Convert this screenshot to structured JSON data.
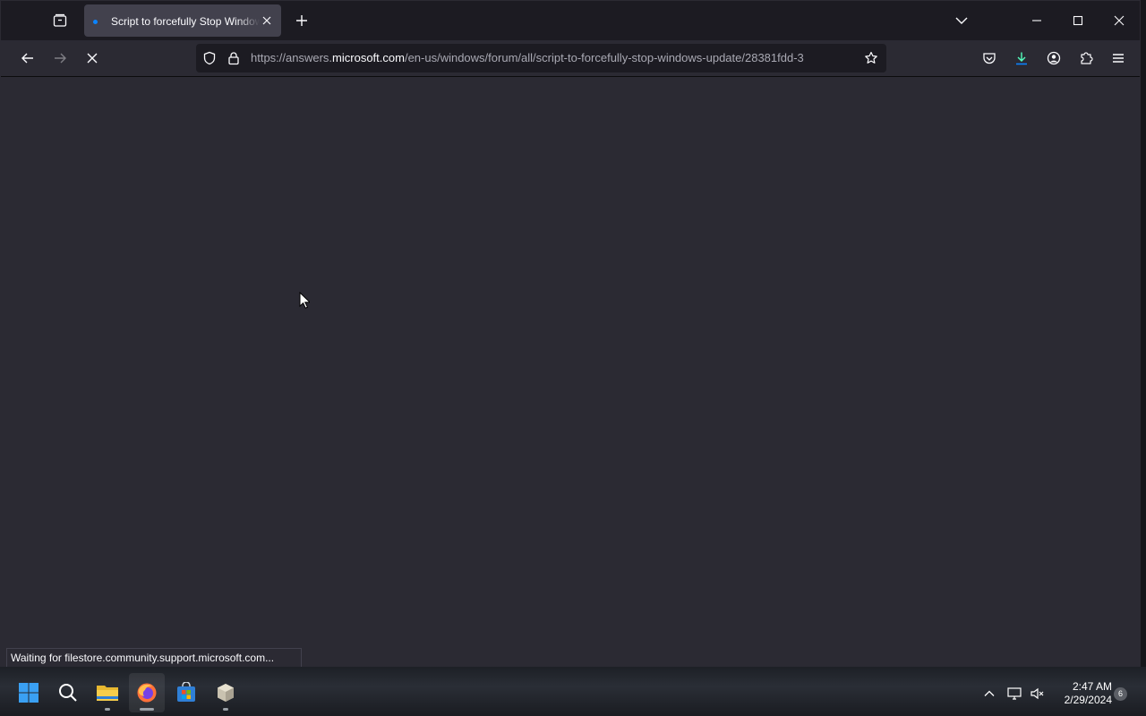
{
  "tab": {
    "title": "Script to forcefully Stop Windows Update"
  },
  "address_bar": {
    "url_prefix": "https://answers.",
    "url_host": "microsoft.com",
    "url_path": "/en-us/windows/forum/all/script-to-forcefully-stop-windows-update/28381fdd-3"
  },
  "status_bar": {
    "text": "Waiting for filestore.community.support.microsoft.com..."
  },
  "taskbar": {
    "apps": [
      "start-icon",
      "search-icon",
      "file-explorer-icon",
      "firefox-icon",
      "store-icon",
      "package-icon"
    ],
    "time": "2:47 AM",
    "date": "2/29/2024",
    "notification_count": "6"
  },
  "colors": {
    "accent": "#0a84ff",
    "download_active": "#54ffbd"
  }
}
